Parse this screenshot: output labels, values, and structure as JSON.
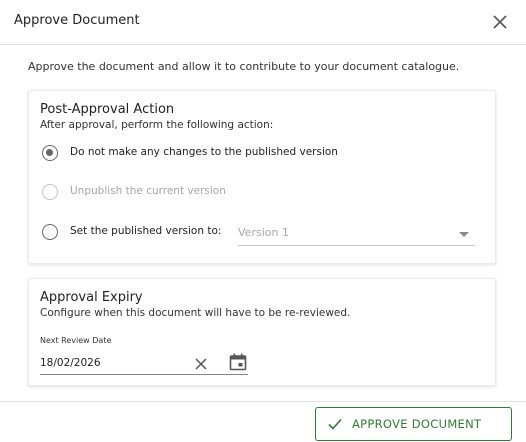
{
  "dialog": {
    "title": "Approve Document",
    "intro": "Approve the document and allow it to contribute to your document catalogue."
  },
  "post_approval": {
    "title": "Post-Approval Action",
    "subtitle": "After approval, perform the following action:",
    "options": [
      {
        "label": "Do not make any changes to the published version",
        "checked": true,
        "disabled": false
      },
      {
        "label": "Unpublish the current version",
        "checked": false,
        "disabled": true
      },
      {
        "label": "Set the published version to:",
        "checked": false,
        "disabled": false
      }
    ],
    "version_select": {
      "placeholder": "Version 1"
    }
  },
  "expiry": {
    "title": "Approval Expiry",
    "subtitle": "Configure when this document will have to be re-reviewed.",
    "field_label": "Next Review Date",
    "date_value": "18/02/2026"
  },
  "footer": {
    "approve_label": "APPROVE DOCUMENT"
  },
  "colors": {
    "accent_green": "#2e7d32",
    "radio_gray": "#666666",
    "disabled_gray": "#a6a6a6"
  },
  "icons": {
    "close": "close-icon",
    "clear": "clear-icon",
    "calendar": "calendar-icon",
    "check": "check-icon",
    "dropdown": "chevron-down-icon"
  }
}
